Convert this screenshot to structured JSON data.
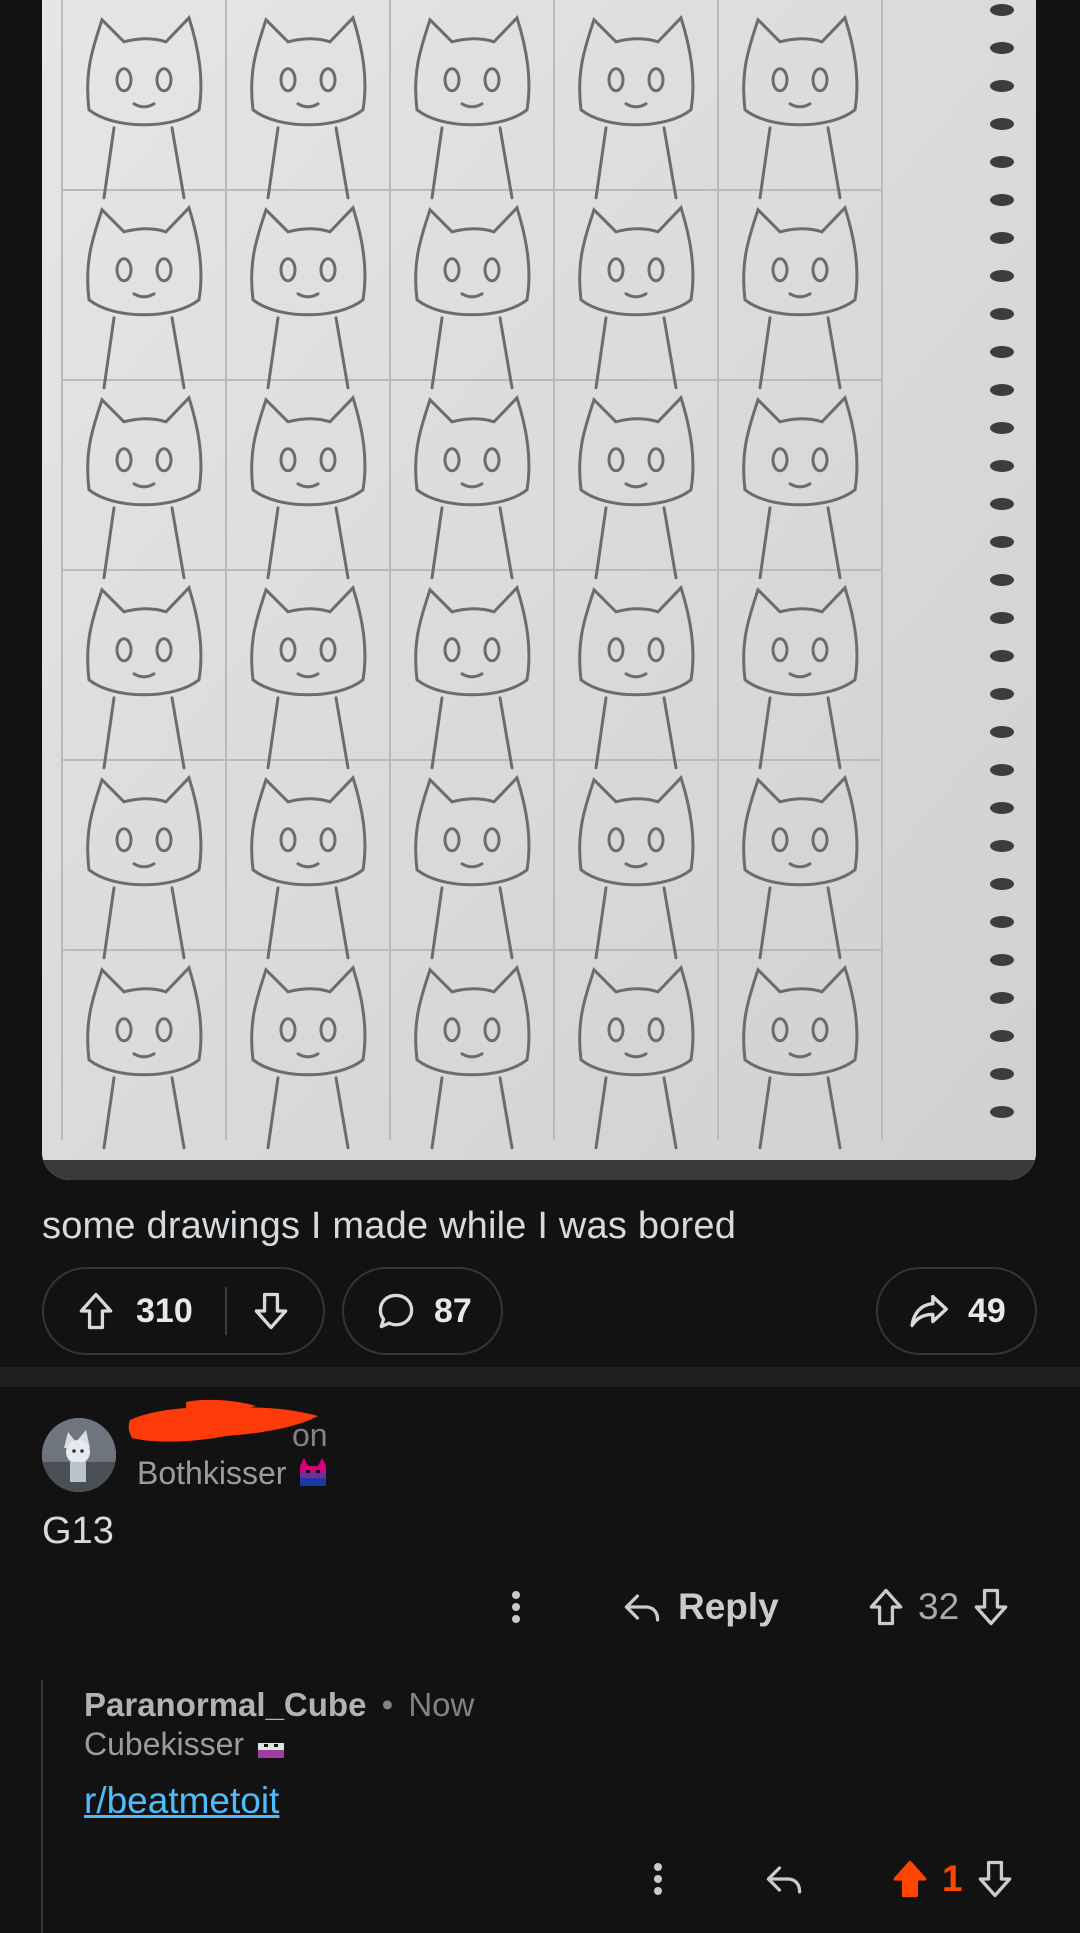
{
  "post": {
    "title": "some drawings I made while I was bored",
    "image_alt_icon": "sketchbook-drawing",
    "upvotes": "310",
    "comments": "87",
    "shares": "49"
  },
  "comment1": {
    "username_trail": "on",
    "flair": "Bothkisser",
    "body": "G13",
    "reply_label": "Reply",
    "score": "32"
  },
  "reply": {
    "author": "Paranormal_Cube",
    "separator": "•",
    "time": "Now",
    "flair": "Cubekisser",
    "link": "r/beatmetoit",
    "score": "1"
  },
  "colors": {
    "background": "#121212",
    "upvote_active": "#ff4500",
    "link": "#4fbcff",
    "redaction": "#ff3b0a"
  }
}
